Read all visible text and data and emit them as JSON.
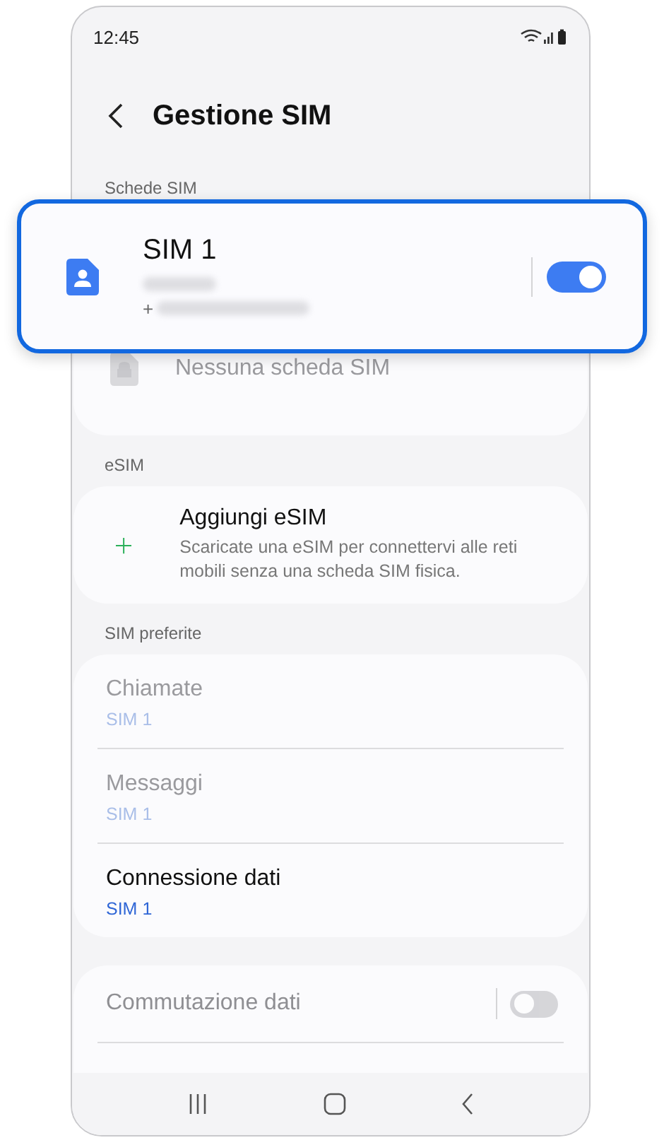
{
  "status_bar": {
    "time": "12:45"
  },
  "header": {
    "title": "Gestione SIM"
  },
  "sim_cards": {
    "label": "Schede SIM",
    "items": [
      {
        "kind": "sim",
        "name": "SIM 1",
        "number_prefix": "+",
        "on": true
      },
      {
        "kind": "empty",
        "name": "Nessuna scheda SIM"
      }
    ]
  },
  "esim": {
    "label": "eSIM",
    "title": "Aggiungi eSIM",
    "description": "Scaricate una eSIM per connettervi alle reti mobili senza una scheda SIM fisica."
  },
  "preferred": {
    "label": "SIM preferite",
    "items": [
      {
        "title": "Chiamate",
        "value": "SIM 1",
        "disabled": true
      },
      {
        "title": "Messaggi",
        "value": "SIM 1",
        "disabled": true
      },
      {
        "title": "Connessione dati",
        "value": "SIM 1",
        "disabled": false
      }
    ]
  },
  "data_switching": {
    "title": "Commutazione dati",
    "on": false,
    "disabled": true
  }
}
